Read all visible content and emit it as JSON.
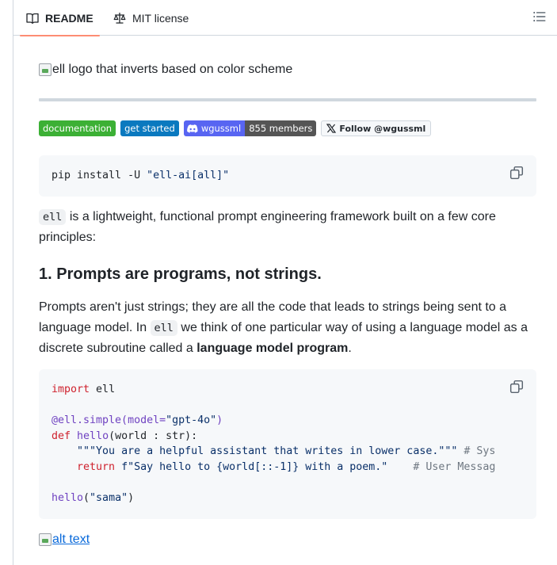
{
  "tabs": {
    "readme": "README",
    "license": "MIT license"
  },
  "logo_alt": "ell logo that inverts based on color scheme",
  "badges": {
    "documentation": "documentation",
    "get_started": "get started",
    "discord_left": "wgussml",
    "discord_right": "855 members",
    "x_follow": "Follow @wgussml"
  },
  "install_cmd_prefix": "pip install -U ",
  "install_cmd_str": "\"ell-ai[all]\"",
  "intro": {
    "code": "ell",
    "text": " is a lightweight, functional prompt engineering framework built on a few core principles:"
  },
  "heading1": "1. Prompts are programs, not strings.",
  "para2": {
    "part1": "Prompts aren't just strings; they are all the code that leads to strings being sent to a language model. In ",
    "code": "ell",
    "part2": " we think of one particular way of using a language model as a discrete subroutine called a ",
    "bold": "language model program",
    "part3": "."
  },
  "code": {
    "l1_kw": "import",
    "l1_rest": " ell",
    "l3_dec": "@ell.simple(",
    "l3_arg": "model=",
    "l3_str": "\"gpt-4o\"",
    "l3_end": ")",
    "l4_kw": "def",
    "l4_fn": "hello",
    "l4_rest": "(world : str):",
    "l5_str": "\"\"\"You are a helpful assistant that writes in lower case.\"\"\"",
    "l5_cm": " # Sys",
    "l6_kw": "return",
    "l6_str": " f\"Say hello to {world[::-1]} with a poem.\"",
    "l6_cm": "    # User Messag",
    "l8_fn": "hello",
    "l8_open": "(",
    "l8_str": "\"sama\"",
    "l8_close": ")"
  },
  "alt_text_link": "alt text",
  "colors": {
    "accent_underline": "#fd8c73",
    "link": "#0969da",
    "keyword": "#cf222e",
    "string": "#0a3069"
  }
}
